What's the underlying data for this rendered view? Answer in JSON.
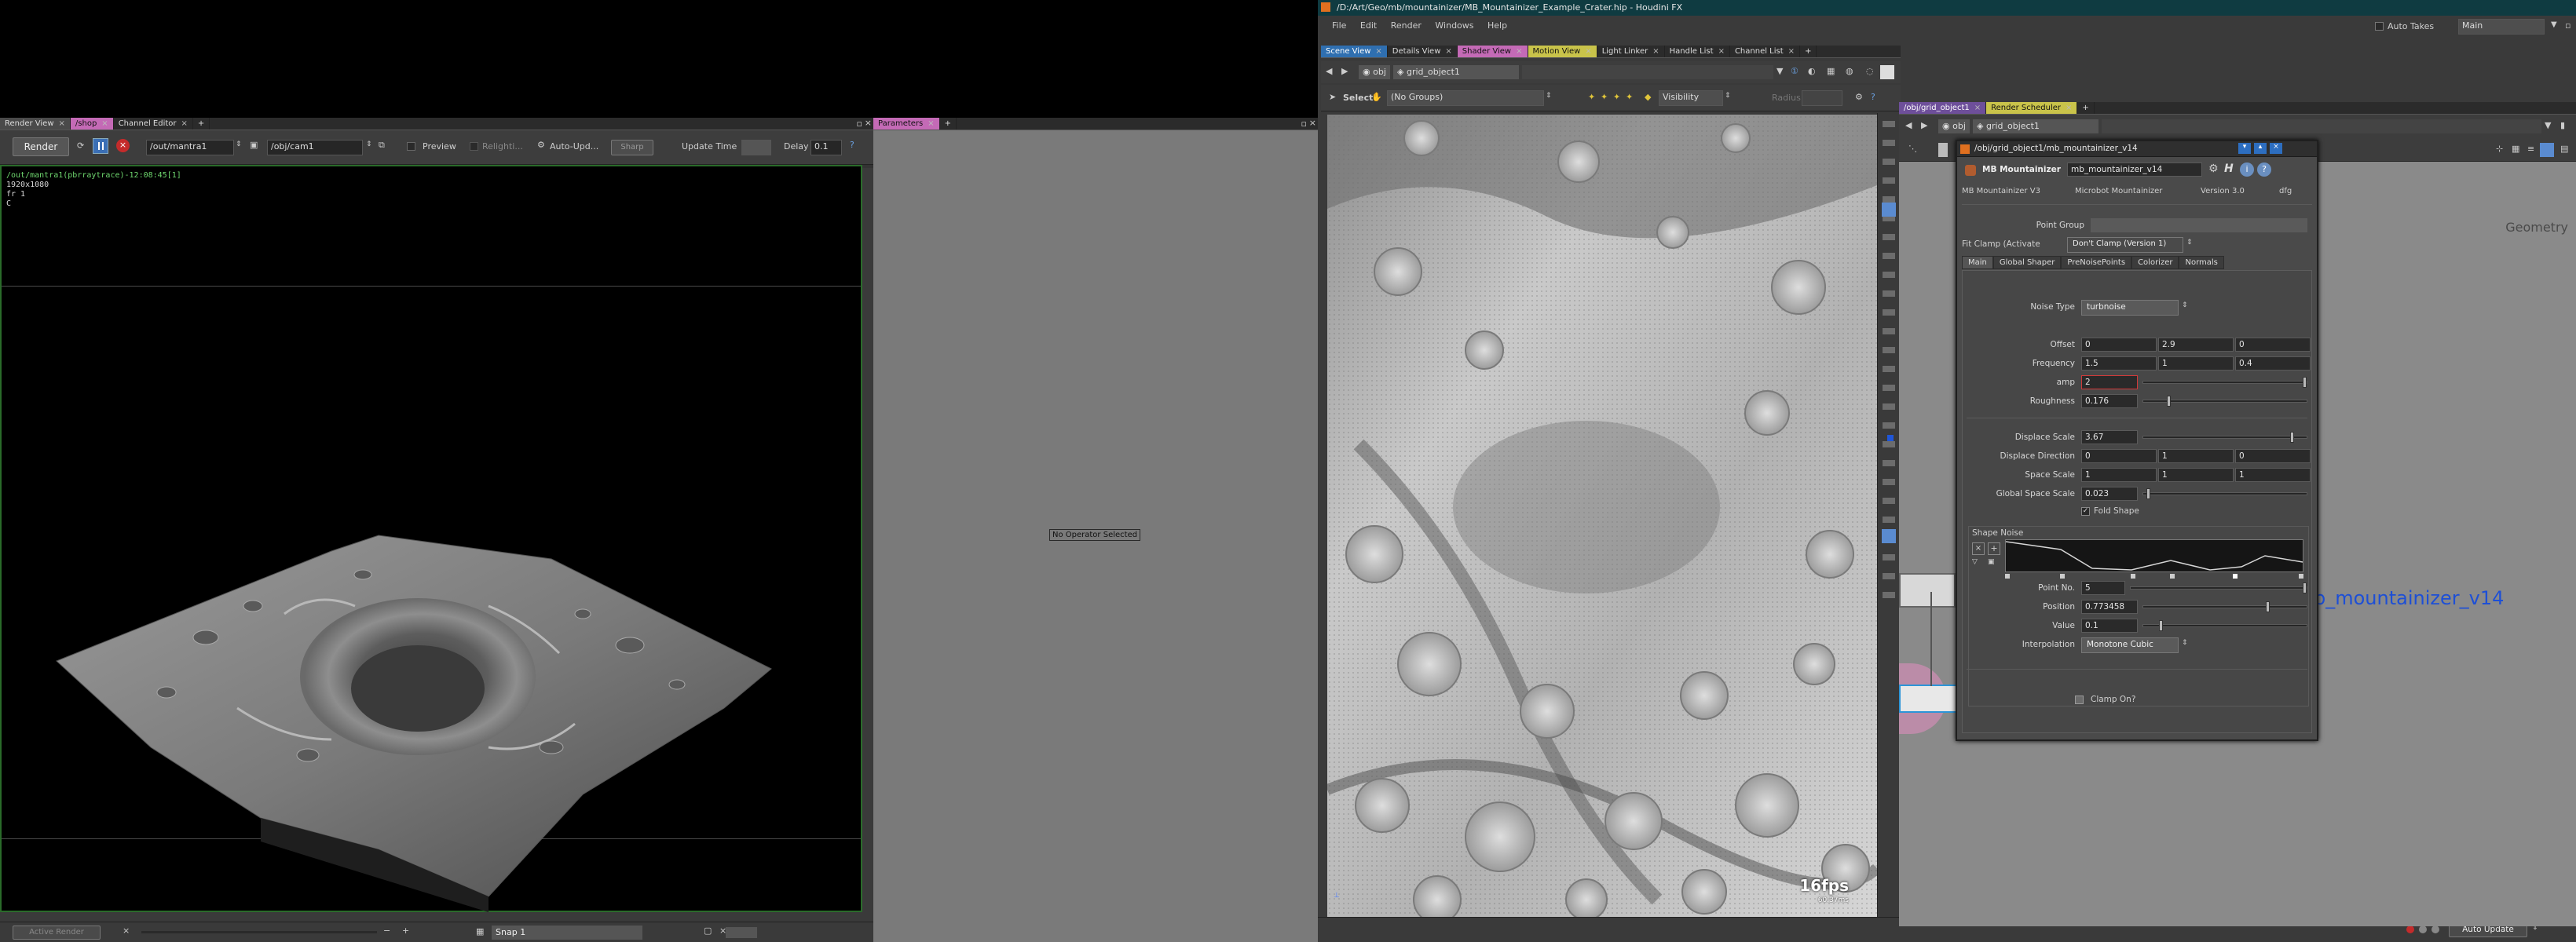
{
  "titlebar": {
    "title": "/D:/Art/Geo/mb/mountainizer/MB_Mountainizer_Example_Crater.hip - Houdini FX"
  },
  "menubar": [
    "File",
    "Edit",
    "Render",
    "Windows",
    "Help"
  ],
  "top_right": {
    "auto_takes_label": "Auto Takes",
    "desktop": "Main"
  },
  "left_tabs": [
    {
      "label": "Render View",
      "style": "act"
    },
    {
      "label": "/shop",
      "style": "pink"
    },
    {
      "label": "Channel Editor",
      "style": "plain"
    }
  ],
  "render_toolbar": {
    "render_button": "Render",
    "renderer_path": "/out/mantra1",
    "camera_path": "/obj/cam1",
    "preview_label": "Preview",
    "relighting_label": "Relighti...",
    "auto_update_label": "Auto-Upd...",
    "sharp_label": "Sharp",
    "update_time_label": "Update Time",
    "delay_label": "Delay",
    "delay_value": "0.1"
  },
  "render_hud": {
    "line1": "/out/mantra1(pbrraytrace)-12:08:45[1]",
    "line2": "1920x1080",
    "line3": "fr 1",
    "line4": "C"
  },
  "render_status": {
    "active_render": "Active Render",
    "snap_label": "Snap",
    "snap_value": "1"
  },
  "param_pane": {
    "tab": "Parameters",
    "empty_message": "No Operator Selected"
  },
  "right_tabs": [
    {
      "label": "Scene View",
      "style": "blue"
    },
    {
      "label": "Details View",
      "style": "plain"
    },
    {
      "label": "Shader View",
      "style": "pink"
    },
    {
      "label": "Motion View",
      "style": "yellow"
    },
    {
      "label": "Light Linker",
      "style": "plain"
    },
    {
      "label": "Handle List",
      "style": "plain"
    },
    {
      "label": "Channel List",
      "style": "plain"
    }
  ],
  "net_tabs": [
    {
      "label": "/obj/grid_object1",
      "style": "purple"
    },
    {
      "label": "Render Scheduler",
      "style": "yellow"
    }
  ],
  "scene_path": {
    "root": "obj",
    "node": "grid_object1"
  },
  "scene_toolbar": {
    "select_label": "Select",
    "groups_value": "(No Groups)",
    "visibility_label": "Visibility",
    "radius_label": "Radius"
  },
  "viewport_stats": {
    "fps": "16fps",
    "ms": "60.37ms"
  },
  "net_path": {
    "root": "obj",
    "node": "grid_object1",
    "context": "Geometry"
  },
  "network_node_label": "b_mountainizer_v14",
  "dialog": {
    "title": "/obj/grid_object1/mb_mountainizer_v14",
    "node_type": "MB Mountainizer",
    "node_name": "mb_mountainizer_v14",
    "info_name": "MB Mountainizer V3",
    "info_author": "Microbot Mountainizer",
    "info_version": "Version 3.0",
    "info_extra": "dfg",
    "point_group_label": "Point Group",
    "point_group_value": "",
    "fit_clamp_label": "Fit Clamp (Activate",
    "fit_clamp_value": "Don't Clamp (Version 1)",
    "tabs": [
      "Main",
      "Global Shaper",
      "PreNoisePoints",
      "Colorizer",
      "Normals"
    ],
    "noise_type_label": "Noise Type",
    "noise_type_value": "turbnoise",
    "offset_label": "Offset",
    "offset_values": [
      "0",
      "2.9",
      "0"
    ],
    "frequency_label": "Frequency",
    "frequency_values": [
      "1.5",
      "1",
      "0.4"
    ],
    "amp_label": "amp",
    "amp_value": "2",
    "roughness_label": "Roughness",
    "roughness_value": "0.176",
    "displace_scale_label": "Displace Scale",
    "displace_scale_value": "3.67",
    "displace_direction_label": "Displace Direction",
    "displace_direction_values": [
      "0",
      "1",
      "0"
    ],
    "space_scale_label": "Space Scale",
    "space_scale_values": [
      "1",
      "1",
      "1"
    ],
    "global_space_scale_label": "Global Space Scale",
    "global_space_scale_value": "0.023",
    "fold_shape_label": "Fold Shape",
    "shape_noise_label": "Shape Noise",
    "point_no_label": "Point No.",
    "point_no_value": "5",
    "position_label": "Position",
    "position_value": "0.773458",
    "value_label": "Value",
    "value_value": "0.1",
    "interpolation_label": "Interpolation",
    "interpolation_value": "Monotone Cubic",
    "clamp_on_label": "Clamp On?",
    "slider_levels": {
      "amp": 1.0,
      "roughness": 0.15,
      "displace_scale": 0.92,
      "global_space_scale": 0.02,
      "point_no": 1.0,
      "position": 0.77,
      "value": 0.1
    }
  },
  "bottom_right": {
    "auto_update": "Auto Update"
  },
  "colors": {
    "accent_blue": "#2f6fb0",
    "render_border": "#2a6b2a",
    "hud_green": "#6fd86f",
    "node_label": "#1d4fd6"
  }
}
